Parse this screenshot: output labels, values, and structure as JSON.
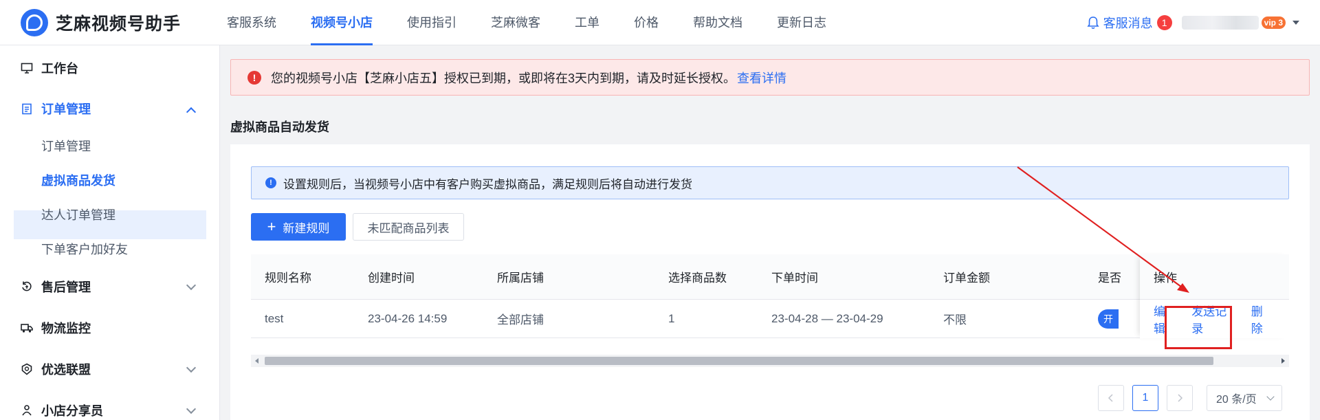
{
  "topbar": {
    "brand": "芝麻视频号助手",
    "nav": [
      "客服系统",
      "视频号小店",
      "使用指引",
      "芝麻微客",
      "工单",
      "价格",
      "帮助文档",
      "更新日志"
    ],
    "active_nav_index": 1,
    "messages_label": "客服消息",
    "messages_count": "1",
    "vip_label": "vip 3"
  },
  "sidebar": {
    "workbench": "工作台",
    "order_group": "订单管理",
    "order_sub": [
      "订单管理",
      "虚拟商品发货",
      "达人订单管理",
      "下单客户加好友"
    ],
    "active_sub_index": 1,
    "after_sales": "售后管理",
    "logistics": "物流监控",
    "alliance": "优选联盟",
    "sharer": "小店分享员"
  },
  "alert": {
    "text": "您的视频号小店【芝麻小店五】授权已到期，或即将在3天内到期，请及时延长授权。",
    "link": "查看详情"
  },
  "page_title": "虚拟商品自动发货",
  "info_text": "设置规则后，当视频号小店中有客户购买虚拟商品，满足规则后将自动进行发货",
  "buttons": {
    "new_rule": "新建规则",
    "unmatched": "未匹配商品列表"
  },
  "table": {
    "headers": [
      "规则名称",
      "创建时间",
      "所属店铺",
      "选择商品数",
      "下单时间",
      "订单金额",
      "是否",
      "操作"
    ],
    "row": {
      "name": "test",
      "created": "23-04-26 14:59",
      "shop": "全部店铺",
      "count": "1",
      "order_time": "23-04-28 — 23-04-29",
      "amount": "不限",
      "toggle": "开"
    },
    "actions": [
      "编辑",
      "发送记录",
      "删除"
    ]
  },
  "pagination": {
    "current": "1",
    "page_size": "20 条/页"
  },
  "colors": {
    "primary": "#2b6ef2",
    "danger": "#e02020",
    "alert_bg": "#fde8e8"
  }
}
